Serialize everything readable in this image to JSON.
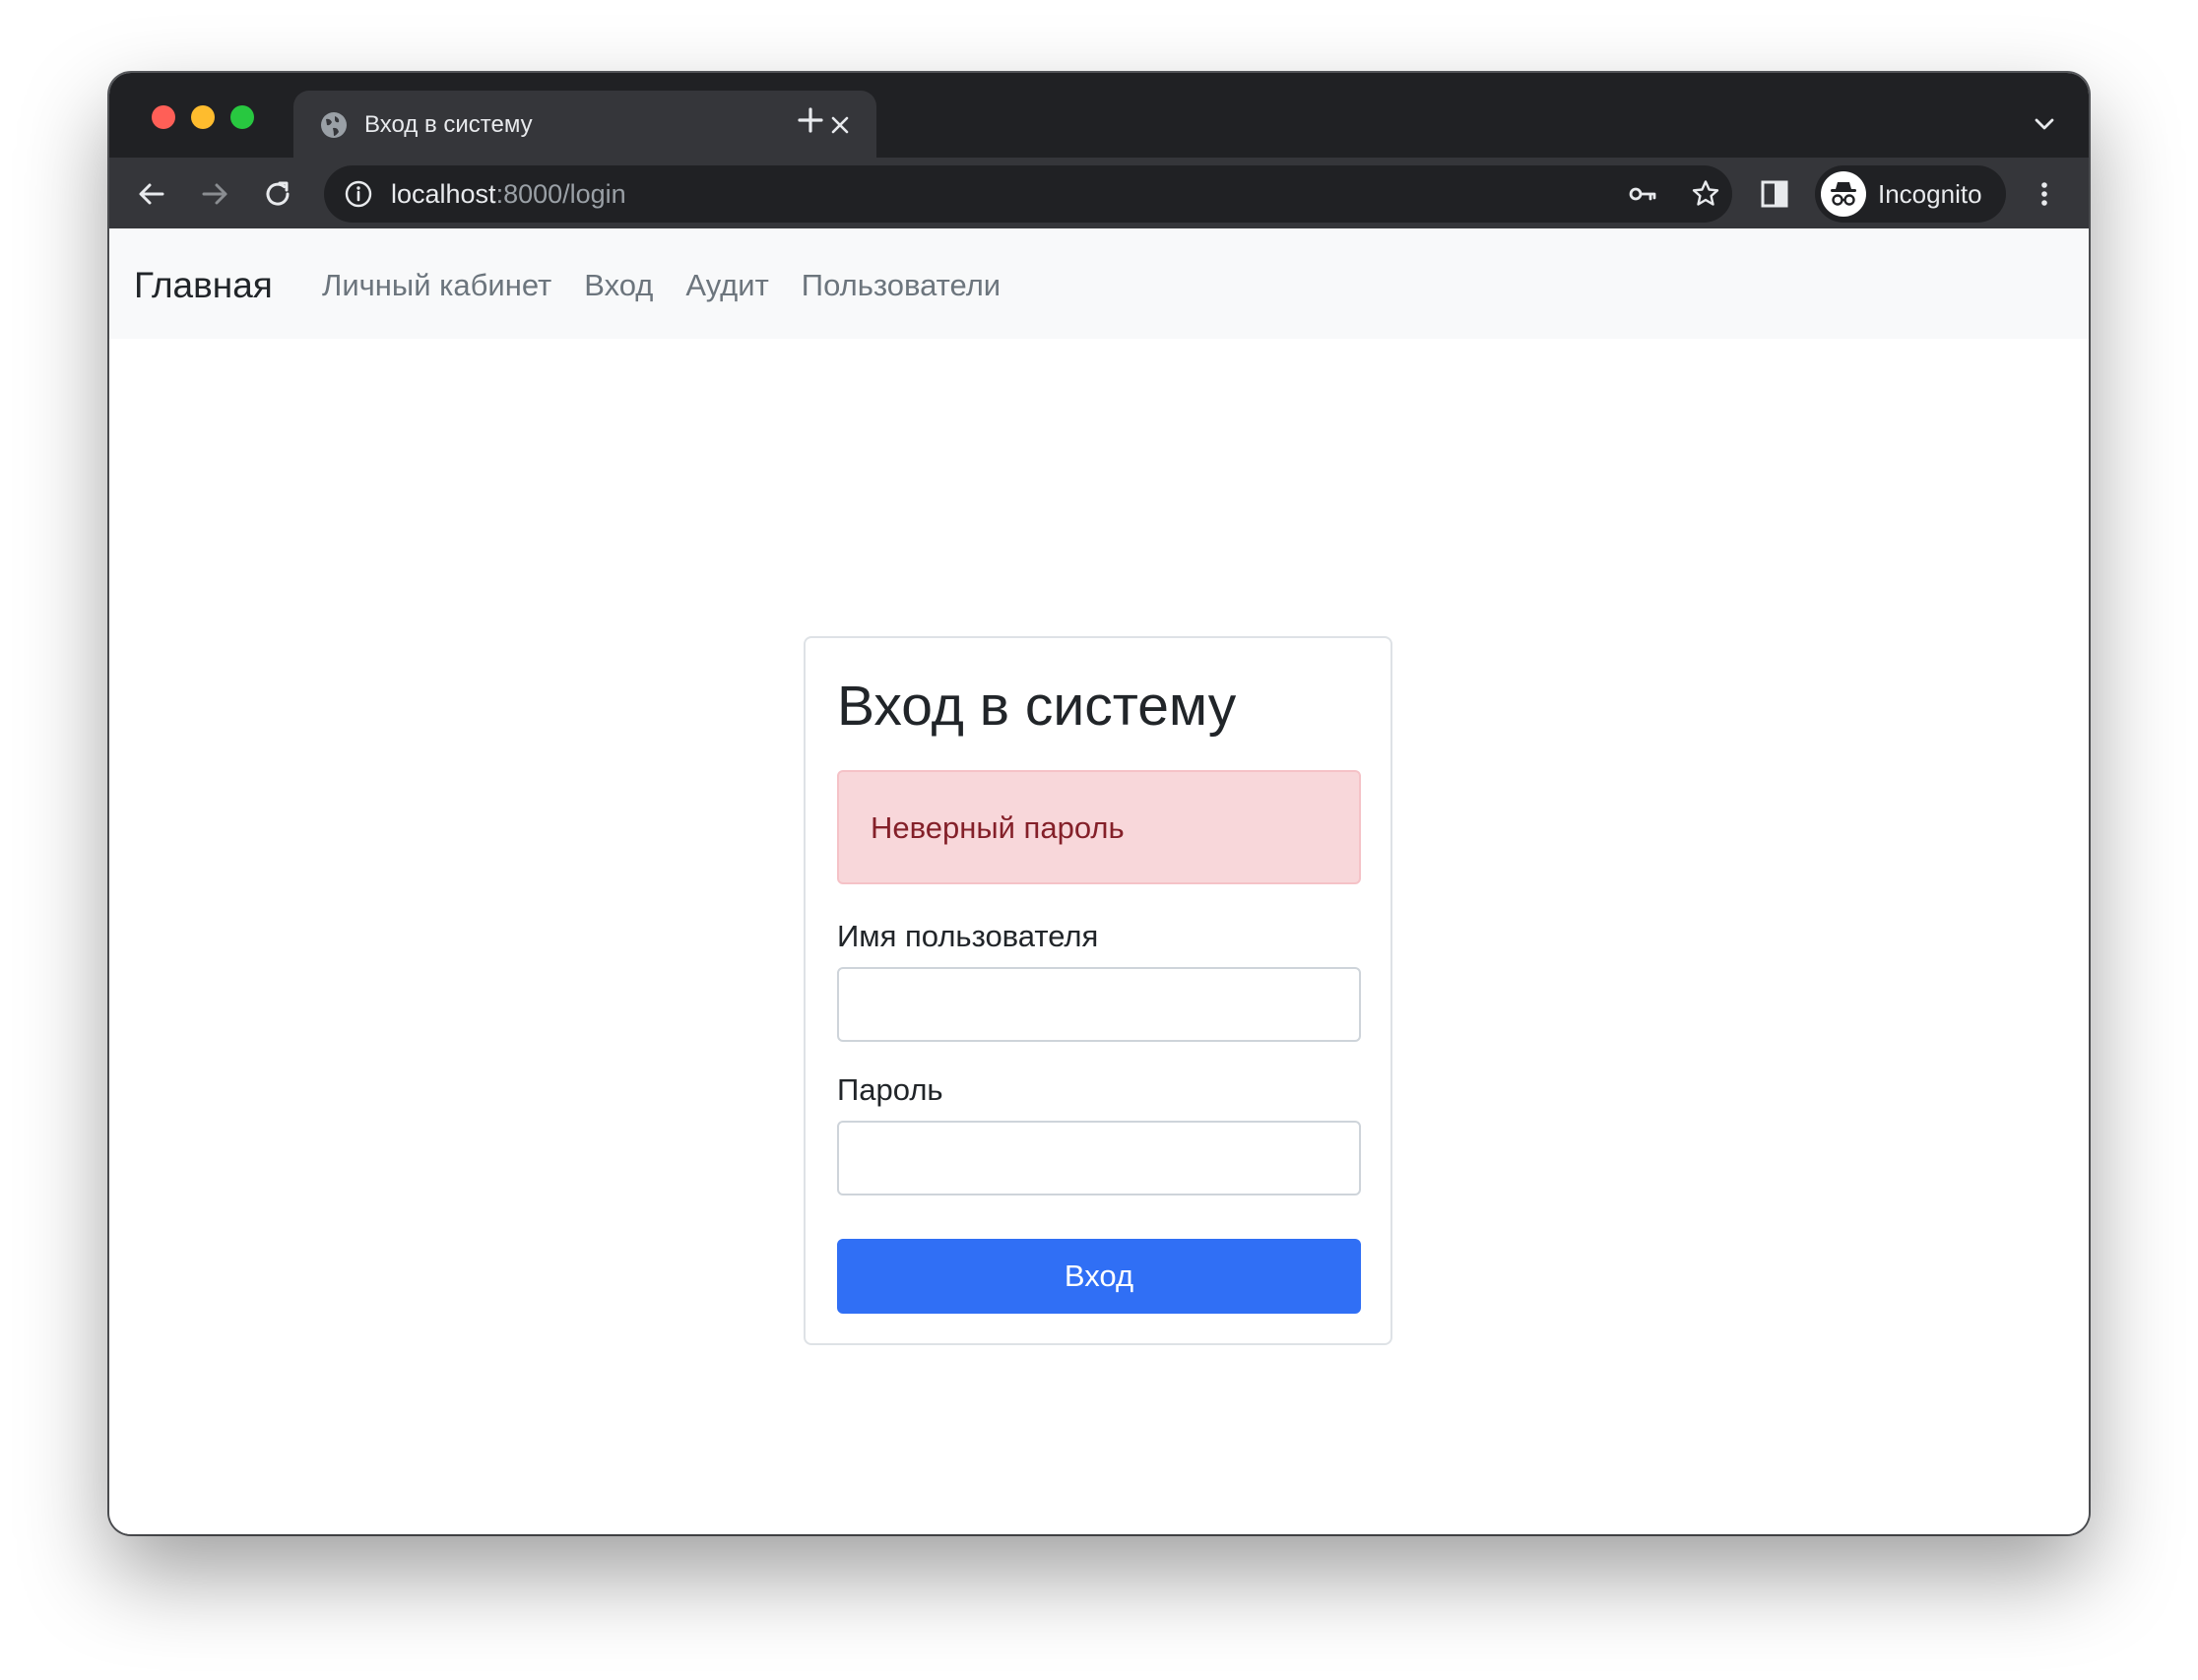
{
  "browser": {
    "tab_title": "Вход в систему",
    "url_host": "localhost",
    "url_rest": ":8000/login",
    "profile_label": "Incognito"
  },
  "navbar": {
    "brand": "Главная",
    "links": [
      "Личный кабинет",
      "Вход",
      "Аудит",
      "Пользователи"
    ]
  },
  "login": {
    "title": "Вход в систему",
    "error": "Неверный пароль",
    "username_label": "Имя пользователя",
    "username_value": "",
    "password_label": "Пароль",
    "password_value": "",
    "submit_label": "Вход"
  },
  "colors": {
    "primary_button": "#306ff5",
    "alert_background": "#f8d7da",
    "alert_text": "#842029",
    "navbar_background": "#f8f9fa"
  },
  "icons": {
    "tab_favicon": "globe-icon",
    "tab_close": "close-icon",
    "new_tab": "plus-icon",
    "tab_search": "chevron-down-icon",
    "back": "arrow-left-icon",
    "forward": "arrow-right-icon",
    "reload": "reload-icon",
    "site_info": "info-icon",
    "password": "key-icon",
    "bookmark": "star-icon",
    "side_panel": "side-panel-icon",
    "incognito": "incognito-icon",
    "menu": "kebab-menu-icon"
  }
}
